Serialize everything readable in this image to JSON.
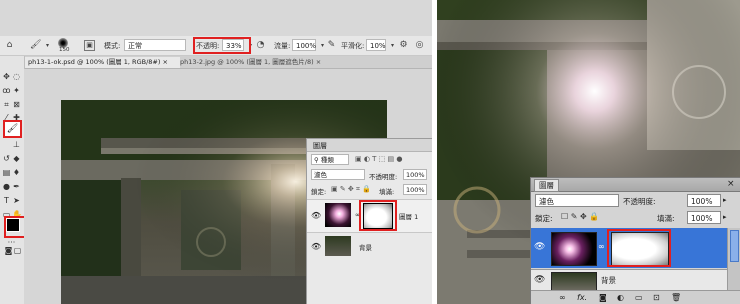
{
  "options_bar": {
    "brush_size": "150",
    "mode_label": "模式:",
    "mode_value": "正常",
    "opacity_label": "不透明:",
    "opacity_value": "33%",
    "flow_label": "流量:",
    "flow_value": "100%",
    "smoothing_label": "平滑化:",
    "smoothing_value": "10%"
  },
  "tabs": [
    {
      "label": "ph13-1-ok.psd @ 100% (圖層 1, RGB/8#)",
      "close": "×"
    },
    {
      "label": "ph13-2.jpg @ 100% (圖層 1, 圖層遮色片/8)",
      "close": "×"
    }
  ],
  "layers_panel": {
    "title": "圖層",
    "filter_label": "種類",
    "blend_value": "濾色",
    "opacity_label": "不透明度:",
    "opacity_value": "100%",
    "lock_label": "鎖定:",
    "fill_label": "填滿:",
    "fill_value": "100%",
    "layers": [
      {
        "name": "圖層 1"
      },
      {
        "name": "背景"
      }
    ]
  },
  "right_panel": {
    "title": "圖層",
    "close": "×",
    "blend_value": "濾色",
    "opacity_label": "不透明度:",
    "opacity_value": "100%",
    "lock_label": "鎖定:",
    "fill_label": "填滿:",
    "fill_value": "100%",
    "background_layer_name": "背景"
  },
  "colors": {
    "highlight": "#e02020",
    "selection": "#3875d7",
    "foreground": "#000000",
    "background": "#ffffff"
  },
  "icons": [
    "brush-icon",
    "move-icon",
    "marquee-icon",
    "lasso-icon",
    "crop-icon",
    "eyedropper-icon",
    "healing-icon",
    "brush-tool-icon",
    "stamp-icon",
    "history-brush-icon",
    "eraser-icon",
    "gradient-icon",
    "blur-icon",
    "dodge-icon",
    "pen-icon",
    "type-icon",
    "path-select-icon",
    "shape-icon",
    "hand-icon",
    "zoom-icon",
    "eye-icon",
    "link-icon",
    "lock-icon",
    "fx-icon"
  ]
}
